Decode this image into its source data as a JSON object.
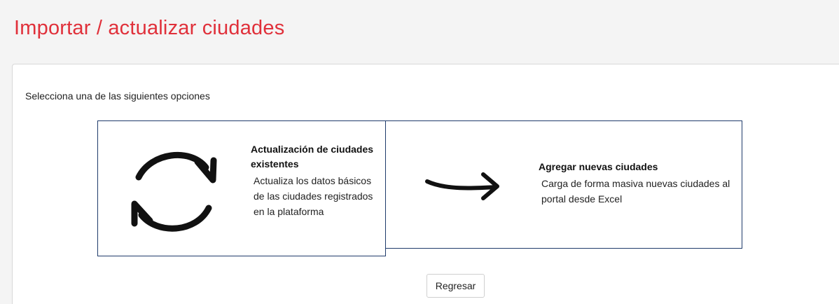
{
  "page": {
    "title": "Importar / actualizar ciudades",
    "title_color": "#e0303a"
  },
  "panel": {
    "instruction": "Selecciona una de las siguientes opciones"
  },
  "options": [
    {
      "icon": "refresh-icon",
      "title": "Actualización de ciudades existentes",
      "description": "Actualiza los datos básicos de las ciudades registrados en la plataforma"
    },
    {
      "icon": "arrow-right-icon",
      "title": "Agregar nuevas ciudades",
      "description": "Carga de forma masiva nuevas ciudades al portal desde Excel"
    }
  ],
  "actions": {
    "back_label": "Regresar"
  },
  "colors": {
    "card_border": "#1f3b6b",
    "background": "#f4f4f4"
  }
}
